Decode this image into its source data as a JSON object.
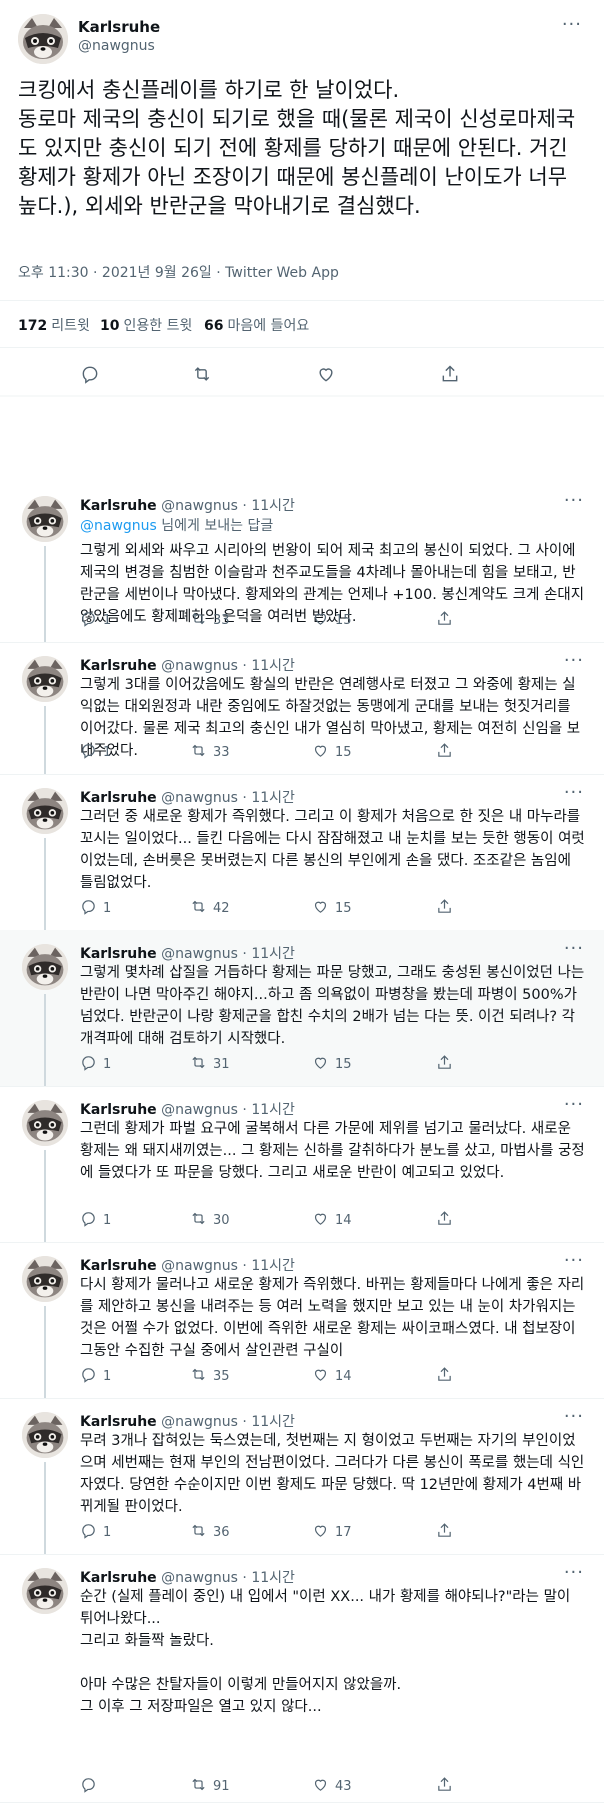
{
  "main_tweet": {
    "name": "Karlsruhe",
    "handle": "@nawgnus",
    "text": "크킹에서 충신플레이를 하기로 한 날이었다.\n동로마 제국의 충신이 되기로 했을 때(물론 제국이 신성로마제국도 있지만 충신이 되기 전에 황제를 당하기 때문에 안된다. 거긴 황제가 황제가 아닌 조장이기 때문에 봉신플레이 난이도가 너무 높다.), 외세와 반란군을 막아내기로 결심했다.",
    "meta": "오후 11:30 · 2021년 9월 26일 · Twitter Web App",
    "retweets_count": "172",
    "retweets_label": "리트윗",
    "quotes_count": "10",
    "quotes_label": "인용한 트윗",
    "likes_count": "66",
    "likes_label": "마음에 들어요",
    "icons": [
      "reply-icon",
      "retweet-icon",
      "like-icon",
      "share-icon"
    ]
  },
  "replies": [
    {
      "name": "Karlsruhe",
      "handle": "@nawgnus",
      "time": "· 11시간",
      "context_mention": "@nawgnus",
      "context_suffix": " 님에게 보내는 답글",
      "text": "그렇게 외세와 싸우고 시리아의 번왕이 되어 제국 최고의 봉신이 되었다. 그 사이에 제국의 변경을 침범한 이슬람과 천주교도들을 4차례나 몰아내는데 힘을 보태고, 반란군을 세번이나 막아냈다. 황제와의 관계는 언제나 +100. 봉신계약도 크게 손대지 않았음에도 황제폐하의 은덕을 여러번 받았다.",
      "reply_count": "1",
      "retweet_count": "33",
      "like_count": "15"
    },
    {
      "name": "Karlsruhe",
      "handle": "@nawgnus",
      "time": "· 11시간",
      "text": "그렇게 3대를 이어갔음에도 황실의 반란은 연례행사로 터졌고 그 와중에 황제는 실익없는 대외원정과 내란 중임에도 하잘것없는 동맹에게 군대를 보내는 헛짓거리를 이어갔다. 물론 제국 최고의 충신인 내가 열심히 막아냈고, 황제는 여전히 신임을 보내주었다.",
      "reply_count": "1",
      "retweet_count": "33",
      "like_count": "15"
    },
    {
      "name": "Karlsruhe",
      "handle": "@nawgnus",
      "time": "· 11시간",
      "text": "그러던 중 새로운 황제가 즉위했다. 그리고 이 황제가 처음으로 한 짓은 내 마누라를 꼬시는 일이었다... 들킨 다음에는 다시 잠잠해졌고 내 눈치를 보는 듯한 행동이 여럿이었는데, 손버릇은 못버렸는지 다른 봉신의 부인에게 손을 댔다. 조조같은 놈임에 틀림없었다.",
      "reply_count": "1",
      "retweet_count": "42",
      "like_count": "15"
    },
    {
      "name": "Karlsruhe",
      "handle": "@nawgnus",
      "time": "· 11시간",
      "text": "그렇게 몇차례 삽질을 거듭하다 황제는 파문 당했고, 그래도 충성된 봉신이었던 나는 반란이 나면 막아주긴 해야지...하고 좀 의욕없이 파병창을 봤는데 파병이 500%가 넘었다. 반란군이 나랑 황제군을 합친 수치의 2배가 넘는 다는 뜻. 이건 되려나? 각개격파에 대해 검토하기 시작했다.",
      "reply_count": "1",
      "retweet_count": "31",
      "like_count": "15"
    },
    {
      "name": "Karlsruhe",
      "handle": "@nawgnus",
      "time": "· 11시간",
      "text": "그런데 황제가 파벌 요구에 굴복해서 다른 가문에 제위를 넘기고 물러났다. 새로운 황제는 왜 돼지새끼였는... 그 황제는 신하를 갈취하다가 분노를 샀고, 마법사를 궁정에 들였다가 또 파문을 당했다. 그리고 새로운 반란이 예고되고 있었다.",
      "reply_count": "1",
      "retweet_count": "30",
      "like_count": "14"
    },
    {
      "name": "Karlsruhe",
      "handle": "@nawgnus",
      "time": "· 11시간",
      "text": "다시 황제가 물러나고 새로운 황제가 즉위했다. 바뀌는 황제들마다 나에게 좋은 자리를 제안하고 봉신을 내려주는 등 여러 노력을 했지만 보고 있는 내 눈이 차가워지는 것은 어쩔 수가 없었다. 이번에 즉위한 새로운 황제는 싸이코패스였다. 내 첩보장이 그동안 수집한 구실 중에서 살인관련 구실이",
      "reply_count": "1",
      "retweet_count": "35",
      "like_count": "14"
    },
    {
      "name": "Karlsruhe",
      "handle": "@nawgnus",
      "time": "· 11시간",
      "text": "무려 3개나 잡혀있는 둑스였는데, 첫번째는 지 형이었고 두번째는 자기의 부인이었으며 세번째는 현재 부인의 전남편이었다. 그러다가 다른 봉신이 폭로를 했는데 식인자였다. 당연한 수순이지만 이번 황제도 파문 당했다. 딱 12년만에 황제가 4번째 바뀌게될 판이었다.",
      "reply_count": "1",
      "retweet_count": "36",
      "like_count": "17"
    },
    {
      "name": "Karlsruhe",
      "handle": "@nawgnus",
      "time": "· 11시간",
      "text": "순간 (실제 플레이 중인) 내 입에서 \"이런 XX... 내가 황제를 해야되나?\"라는 말이 튀어나왔다...\n그리고 화들짝 놀랐다.\n\n아마 수많은 찬탈자들이 이렇게 만들어지지 않았을까.\n그 이후 그 저장파일은 열고 있지 않다...",
      "reply_count": "",
      "retweet_count": "91",
      "like_count": "43"
    }
  ]
}
